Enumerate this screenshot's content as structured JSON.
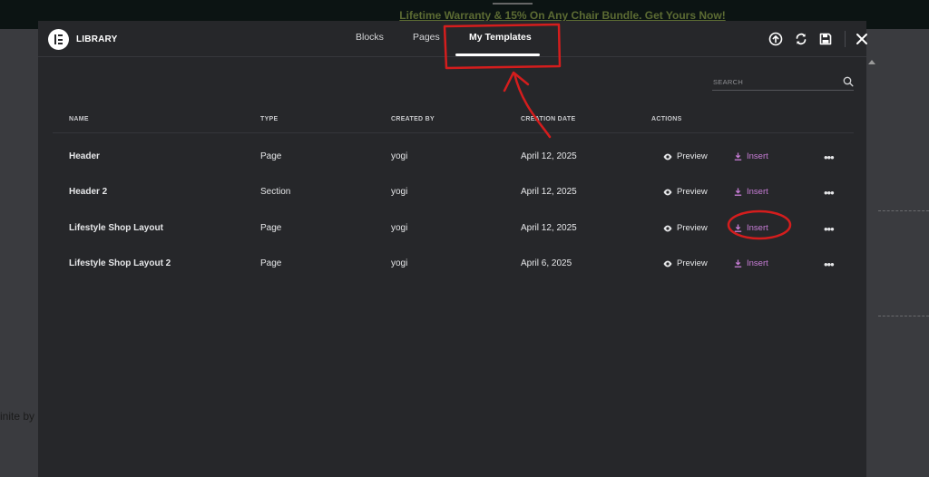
{
  "background": {
    "promo_text": "Lifetime Warranty & 15% On Any Chair Bundle. Get Yours Now!",
    "left_text": "inite by"
  },
  "header": {
    "logo_icon": "elementor-logo-icon",
    "title": "LIBRARY",
    "tabs": [
      {
        "label": "Blocks",
        "active": false
      },
      {
        "label": "Pages",
        "active": false
      },
      {
        "label": "My Templates",
        "active": true
      }
    ],
    "icons": [
      "upload-icon",
      "sync-icon",
      "save-icon",
      "close-icon"
    ]
  },
  "search": {
    "placeholder": "SEARCH",
    "icon": "search-icon"
  },
  "table": {
    "columns": [
      "NAME",
      "TYPE",
      "CREATED BY",
      "CREATION DATE",
      "ACTIONS"
    ],
    "rows": [
      {
        "name": "Header",
        "type": "Page",
        "created_by": "yogi",
        "date": "April 12, 2025",
        "preview": "Preview",
        "insert": "Insert"
      },
      {
        "name": "Header 2",
        "type": "Section",
        "created_by": "yogi",
        "date": "April 12, 2025",
        "preview": "Preview",
        "insert": "Insert"
      },
      {
        "name": "Lifestyle Shop Layout",
        "type": "Page",
        "created_by": "yogi",
        "date": "April 12, 2025",
        "preview": "Preview",
        "insert": "Insert"
      },
      {
        "name": "Lifestyle Shop Layout 2",
        "type": "Page",
        "created_by": "yogi",
        "date": "April 6, 2025",
        "preview": "Preview",
        "insert": "Insert"
      }
    ]
  },
  "colors": {
    "modal_bg": "#26272a",
    "insert_accent": "#c97ed8",
    "annotation_red": "#d41d1d"
  }
}
